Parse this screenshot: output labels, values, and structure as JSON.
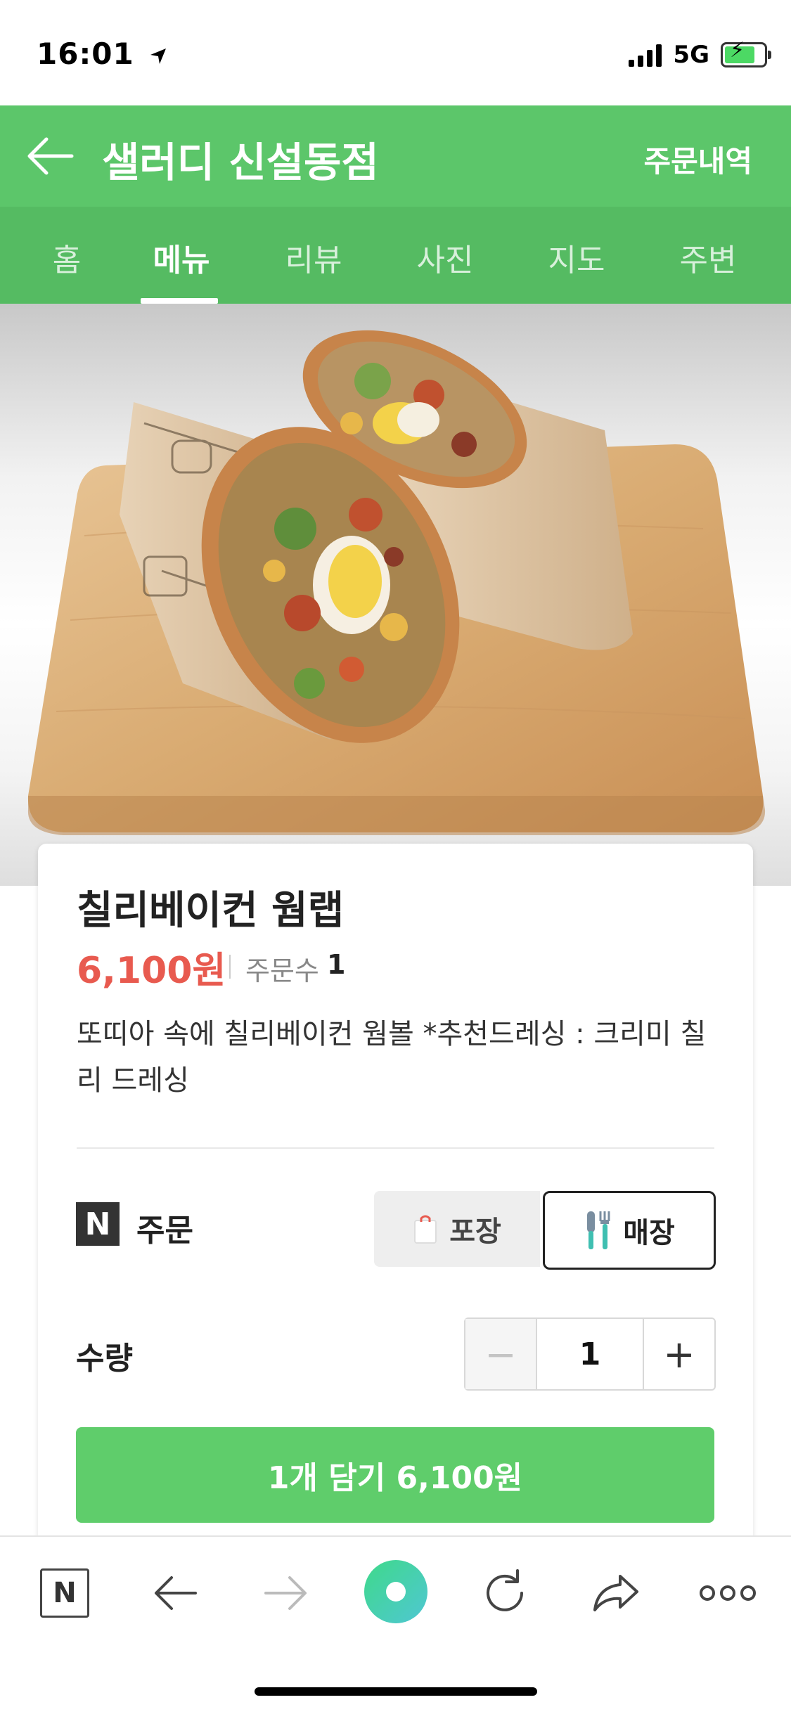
{
  "status_bar": {
    "time": "16:01",
    "network": "5G"
  },
  "header": {
    "title": "샐러디 신설동점",
    "order_history": "주문내역"
  },
  "tabs": [
    {
      "label": "홈",
      "active": false
    },
    {
      "label": "메뉴",
      "active": true
    },
    {
      "label": "리뷰",
      "active": false
    },
    {
      "label": "사진",
      "active": false
    },
    {
      "label": "지도",
      "active": false
    },
    {
      "label": "주변",
      "active": false
    }
  ],
  "product": {
    "name": "칠리베이컨 웜랩",
    "price": "6,100원",
    "order_count_label": "주문수",
    "order_count": "1",
    "description": "또띠아 속에 칠리베이컨 웜볼 *추천드레싱 : 크리미 칠리 드레싱"
  },
  "order": {
    "badge": "N",
    "label": "주문",
    "options": [
      {
        "label": "포장",
        "icon": "bag-icon",
        "selected": false
      },
      {
        "label": "매장",
        "icon": "fork-knife-icon",
        "selected": true
      }
    ]
  },
  "quantity": {
    "label": "수량",
    "value": "1",
    "minus": "−",
    "plus": "+"
  },
  "add_button": {
    "label": "1개 담기 6,100원"
  },
  "browser_bar": {
    "icons": [
      "naver-n-icon",
      "back-arrow-icon",
      "forward-arrow-icon",
      "green-dot-icon",
      "refresh-icon",
      "share-icon",
      "more-icon"
    ],
    "n_label": "N"
  },
  "colors": {
    "brand_green": "#5cc66a",
    "tab_green": "#55bb62",
    "price_red": "#e85a4f",
    "button_green": "#5fcd6b"
  }
}
